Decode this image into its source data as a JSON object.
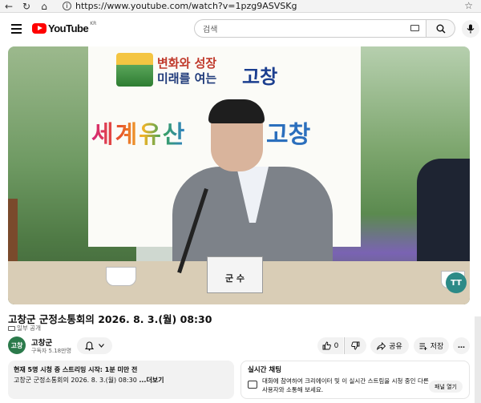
{
  "browser": {
    "url": "https://www.youtube.com/watch?v=1pzg9ASVSKg"
  },
  "masthead": {
    "logo_text": "YouTube",
    "country": "KR",
    "search_placeholder": "검색"
  },
  "video": {
    "banner_slogan_1": "변화와 성장",
    "banner_slogan_2": "미래를 여는",
    "banner_city": "고창",
    "banner_heritage": "세계유산",
    "banner_heritage_city": "고창",
    "nameplate": "군 수",
    "channel_badge": "TT"
  },
  "info": {
    "title": "고창군 군정소통회의 2026. 8. 3.(월) 08:30",
    "caption_badge": "일부 공개"
  },
  "channel": {
    "name": "고창군",
    "subscribers": "구독자 5.18만명",
    "avatar_text": "고창"
  },
  "actions": {
    "like_count": "0",
    "share_label": "공유",
    "save_label": "저장",
    "more_label": "…"
  },
  "description": {
    "stats": "현재 5명 시청 중  스트리밍 시작: 1분 미만 전",
    "text": "고창군 군정소통회의 2026. 8. 3.(월) 08:30",
    "more_label": "...더보기"
  },
  "live_chat": {
    "heading": "실시간 채팅",
    "message": "대화에 참여하여 크리에이터 및 이 실시간 스트림을 시청 중인 다른 사용자와 소통해 보세요.",
    "open_label": "패널 열기"
  }
}
